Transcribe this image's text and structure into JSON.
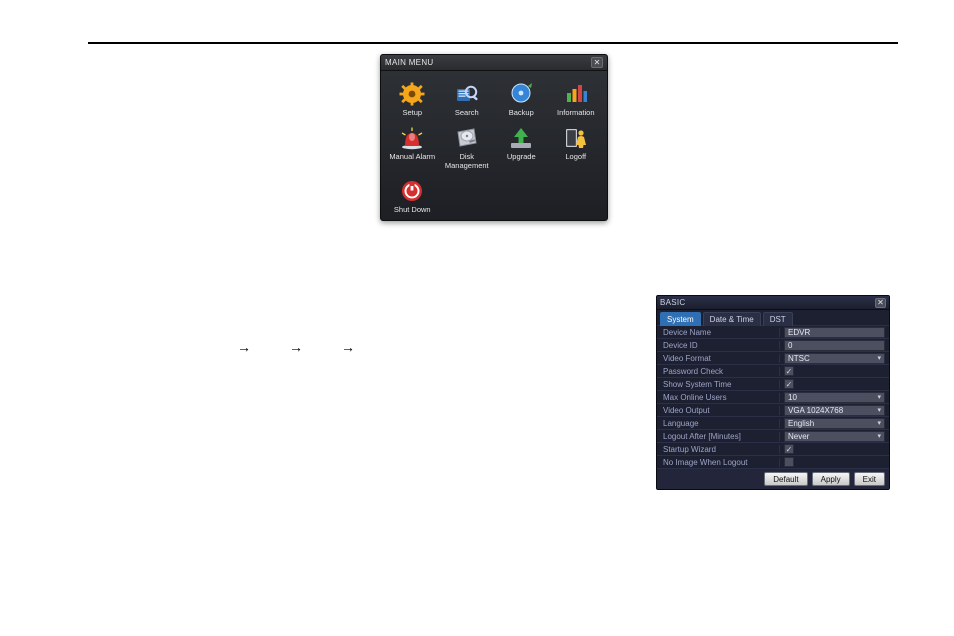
{
  "main_menu": {
    "title": "MAIN MENU",
    "close_glyph": "✕",
    "items": [
      {
        "label": "Setup",
        "icon": "gear-icon"
      },
      {
        "label": "Search",
        "icon": "magnifier-icon"
      },
      {
        "label": "Backup",
        "icon": "disc-icon"
      },
      {
        "label": "Information",
        "icon": "bars-icon"
      },
      {
        "label": "Manual Alarm",
        "icon": "alarm-bell-icon"
      },
      {
        "label": "Disk Management",
        "icon": "hdd-icon"
      },
      {
        "label": "Upgrade",
        "icon": "upgrade-arrow-icon"
      },
      {
        "label": "Logoff",
        "icon": "logoff-person-icon"
      },
      {
        "label": "Shut Down",
        "icon": "power-icon"
      }
    ]
  },
  "arrows": {
    "glyph1": "→",
    "glyph2": "→",
    "glyph3": "→"
  },
  "basic": {
    "title": "BASIC",
    "close_glyph": "✕",
    "tabs": {
      "system": "System",
      "datetime": "Date & Time",
      "dst": "DST",
      "active": "system"
    },
    "rows": {
      "device_name": {
        "label": "Device Name",
        "value": "EDVR",
        "type": "text"
      },
      "device_id": {
        "label": "Device ID",
        "value": "0",
        "type": "text"
      },
      "video_format": {
        "label": "Video Format",
        "value": "NTSC",
        "type": "select"
      },
      "password_check": {
        "label": "Password Check",
        "checked": true,
        "type": "checkbox"
      },
      "show_sys_time": {
        "label": "Show System Time",
        "checked": true,
        "type": "checkbox"
      },
      "max_online": {
        "label": "Max Online Users",
        "value": "10",
        "type": "select"
      },
      "video_output": {
        "label": "Video Output",
        "value": "VGA 1024X768",
        "type": "select"
      },
      "language": {
        "label": "Language",
        "value": "English",
        "type": "select"
      },
      "logout_after": {
        "label": "Logout After [Minutes]",
        "value": "Never",
        "type": "select"
      },
      "startup_wizard": {
        "label": "Startup Wizard",
        "checked": true,
        "type": "checkbox"
      },
      "no_image": {
        "label": "No Image When Logout",
        "checked": false,
        "type": "checkbox"
      }
    },
    "buttons": {
      "default": "Default",
      "apply": "Apply",
      "exit": "Exit"
    }
  }
}
